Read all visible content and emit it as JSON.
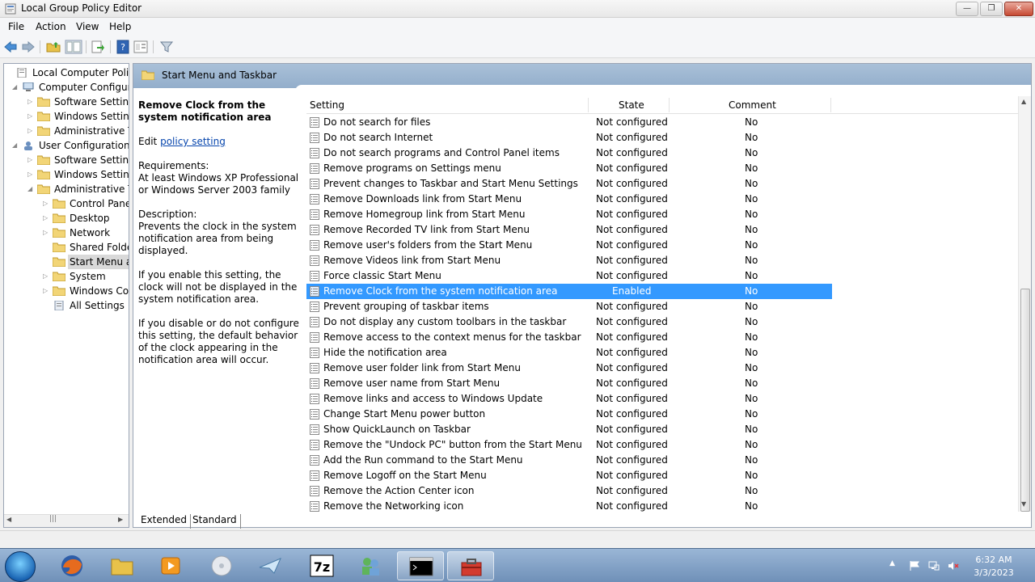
{
  "window": {
    "title": "Local Group Policy Editor",
    "buttons": {
      "minimize": "—",
      "maximize": "❐",
      "close": "✕"
    }
  },
  "menu": {
    "file": "File",
    "action": "Action",
    "view": "View",
    "help": "Help"
  },
  "toolbar": {
    "icons": [
      "back-arrow-icon",
      "forward-arrow-icon",
      "up-folder-icon",
      "show-hide-console-tree-icon",
      "export-list-icon",
      "help-icon",
      "extended-view-icon",
      "filter-icon"
    ]
  },
  "tree": {
    "nodes": [
      {
        "label": "Local Computer Policy",
        "expander": "",
        "icon": "policy-icon"
      },
      {
        "label": "Computer Configura",
        "expander": "◢",
        "icon": "computer-icon"
      },
      {
        "label": "Software Settings",
        "expander": "▷",
        "icon": "folder-icon"
      },
      {
        "label": "Windows Setting",
        "expander": "▷",
        "icon": "folder-icon"
      },
      {
        "label": "Administrative Te",
        "expander": "▷",
        "icon": "folder-icon"
      },
      {
        "label": "User Configuration",
        "expander": "◢",
        "icon": "user-icon"
      },
      {
        "label": "Software Settings",
        "expander": "▷",
        "icon": "folder-icon"
      },
      {
        "label": "Windows Setting",
        "expander": "▷",
        "icon": "folder-icon"
      },
      {
        "label": "Administrative Te",
        "expander": "◢",
        "icon": "folder-icon"
      },
      {
        "label": "Control Panel",
        "expander": "▷",
        "icon": "folder-icon"
      },
      {
        "label": "Desktop",
        "expander": "▷",
        "icon": "folder-icon"
      },
      {
        "label": "Network",
        "expander": "▷",
        "icon": "folder-icon"
      },
      {
        "label": "Shared Folder",
        "expander": "",
        "icon": "folder-icon"
      },
      {
        "label": "Start Menu ar",
        "expander": "",
        "icon": "folder-icon",
        "selected": true
      },
      {
        "label": "System",
        "expander": "▷",
        "icon": "folder-icon"
      },
      {
        "label": "Windows Cor",
        "expander": "▷",
        "icon": "folder-icon"
      },
      {
        "label": "All Settings",
        "expander": "",
        "icon": "all-settings-icon"
      }
    ],
    "scroll_arrow_left": "◀",
    "scroll_arrow_right": "▶",
    "scroll_thumb": "|||"
  },
  "pane": {
    "header_title": "Start Menu and Taskbar",
    "description": {
      "title": "Remove Clock from the system notification area",
      "edit_prefix": "Edit",
      "edit_link": "policy setting",
      "requirements_label": "Requirements:",
      "requirements_text": "At least Windows XP Professional or Windows Server 2003 family",
      "description_label": "Description:",
      "description_text": "Prevents the clock in the system notification area from being displayed.",
      "enable_text": "If you enable this setting, the clock will not be displayed in the system notification area.",
      "disable_text": "If you disable or do not configure this setting, the default behavior of the clock appearing in the notification area will occur."
    },
    "columns": {
      "setting": "Setting",
      "state": "State",
      "comment": "Comment"
    },
    "rows": [
      {
        "setting": "Do not search for files",
        "state": "Not configured",
        "comment": "No"
      },
      {
        "setting": "Do not search Internet",
        "state": "Not configured",
        "comment": "No"
      },
      {
        "setting": "Do not search programs and Control Panel items",
        "state": "Not configured",
        "comment": "No"
      },
      {
        "setting": "Remove programs on Settings menu",
        "state": "Not configured",
        "comment": "No"
      },
      {
        "setting": "Prevent changes to Taskbar and Start Menu Settings",
        "state": "Not configured",
        "comment": "No"
      },
      {
        "setting": "Remove Downloads link from Start Menu",
        "state": "Not configured",
        "comment": "No"
      },
      {
        "setting": "Remove Homegroup link from Start Menu",
        "state": "Not configured",
        "comment": "No"
      },
      {
        "setting": "Remove Recorded TV link from Start Menu",
        "state": "Not configured",
        "comment": "No"
      },
      {
        "setting": "Remove user's folders from the Start Menu",
        "state": "Not configured",
        "comment": "No"
      },
      {
        "setting": "Remove Videos link from Start Menu",
        "state": "Not configured",
        "comment": "No"
      },
      {
        "setting": "Force classic Start Menu",
        "state": "Not configured",
        "comment": "No"
      },
      {
        "setting": "Remove Clock from the system notification area",
        "state": "Enabled",
        "comment": "No",
        "selected": true
      },
      {
        "setting": "Prevent grouping of taskbar items",
        "state": "Not configured",
        "comment": "No"
      },
      {
        "setting": "Do not display any custom toolbars in the taskbar",
        "state": "Not configured",
        "comment": "No"
      },
      {
        "setting": "Remove access to the context menus for the taskbar",
        "state": "Not configured",
        "comment": "No"
      },
      {
        "setting": "Hide the notification area",
        "state": "Not configured",
        "comment": "No"
      },
      {
        "setting": "Remove user folder link from Start Menu",
        "state": "Not configured",
        "comment": "No"
      },
      {
        "setting": "Remove user name from Start Menu",
        "state": "Not configured",
        "comment": "No"
      },
      {
        "setting": "Remove links and access to Windows Update",
        "state": "Not configured",
        "comment": "No"
      },
      {
        "setting": "Change Start Menu power button",
        "state": "Not configured",
        "comment": "No"
      },
      {
        "setting": "Show QuickLaunch on Taskbar",
        "state": "Not configured",
        "comment": "No"
      },
      {
        "setting": "Remove the \"Undock PC\" button from the Start Menu",
        "state": "Not configured",
        "comment": "No"
      },
      {
        "setting": "Add the Run command to the Start Menu",
        "state": "Not configured",
        "comment": "No"
      },
      {
        "setting": "Remove Logoff on the Start Menu",
        "state": "Not configured",
        "comment": "No"
      },
      {
        "setting": "Remove the Action Center icon",
        "state": "Not configured",
        "comment": "No"
      },
      {
        "setting": "Remove the Networking icon",
        "state": "Not configured",
        "comment": "No"
      }
    ],
    "scroll_up": "▲",
    "scroll_down": "▼",
    "tabs": {
      "extended": "Extended",
      "standard": "Standard"
    }
  },
  "taskbar": {
    "apps": [
      "windows-explorer-icon",
      "firefox-icon",
      "file-manager-icon",
      "media-player-icon",
      "disc-icon",
      "mail-icon",
      "7zip-icon",
      "users-icon",
      "command-prompt-icon",
      "toolbox-icon"
    ],
    "time": "6:32 AM",
    "date": "3/3/2023",
    "tray_arrow": "▲"
  },
  "colors": {
    "selection": "#3399ff",
    "header_band": "#a9c0d8",
    "link": "#0645ad"
  }
}
